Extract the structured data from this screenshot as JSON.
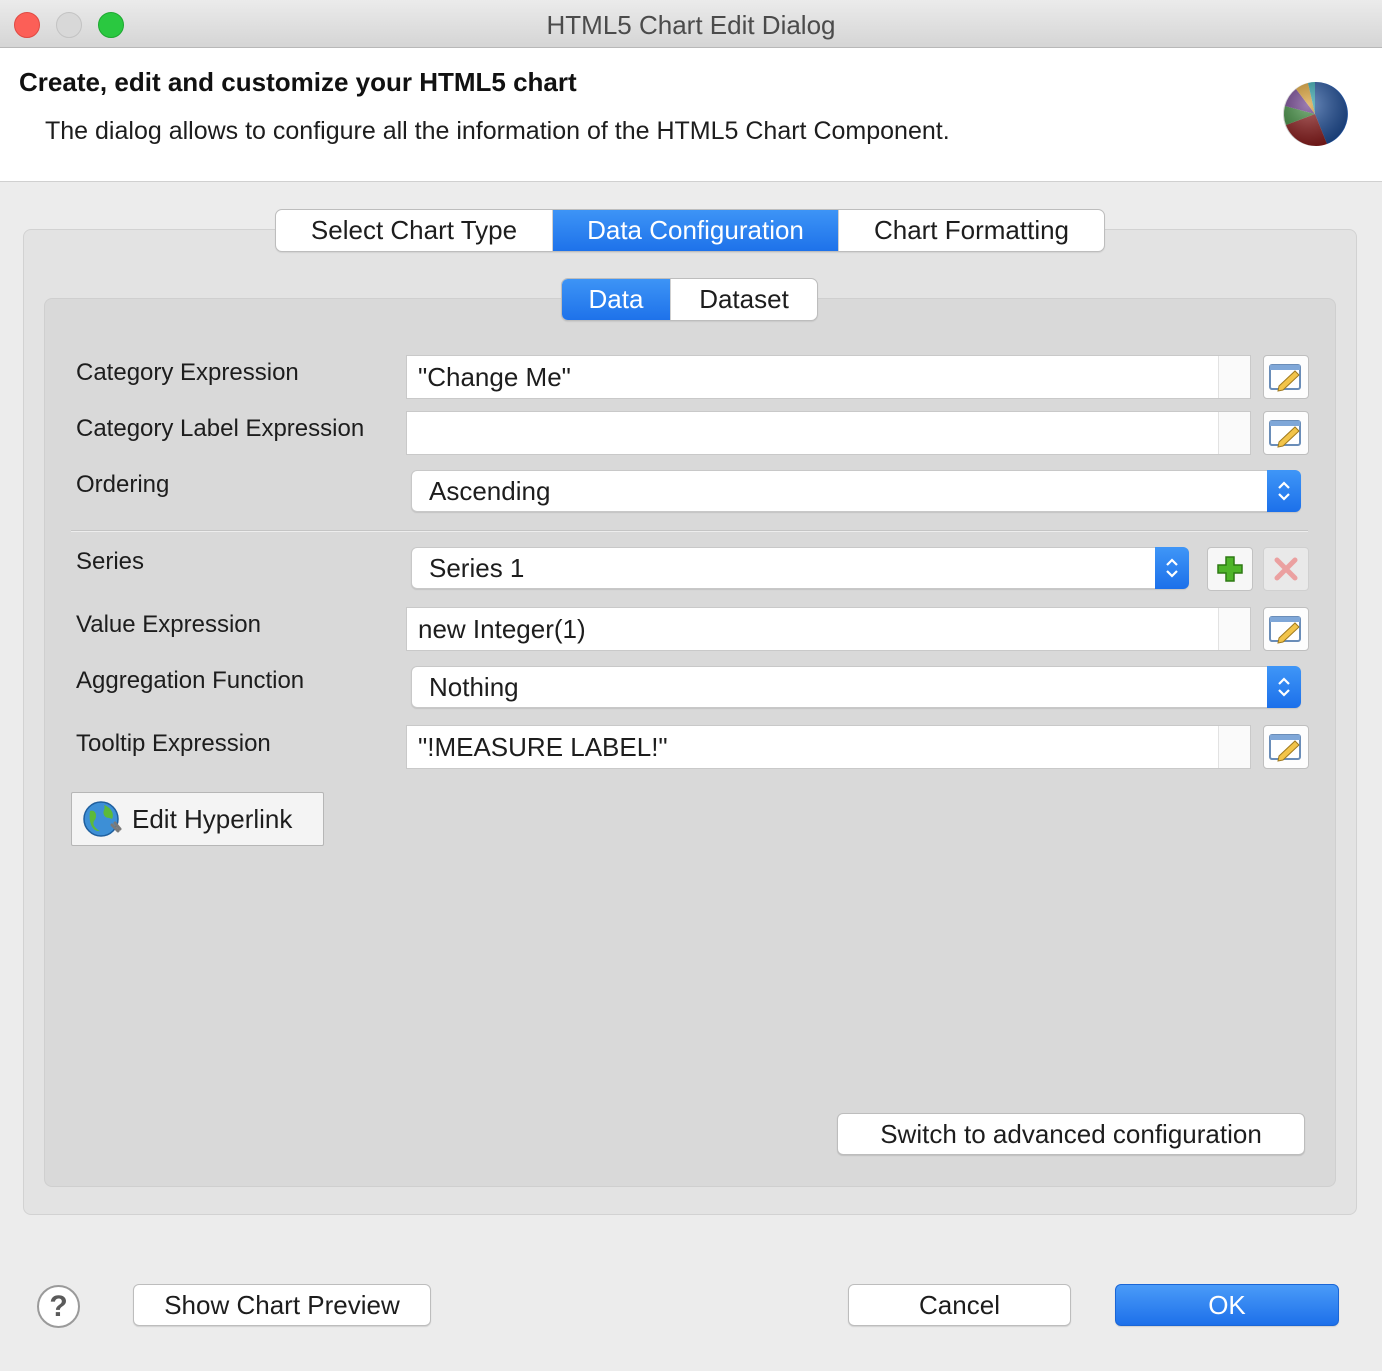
{
  "window": {
    "title": "HTML5 Chart Edit Dialog"
  },
  "banner": {
    "title": "Create, edit and customize your HTML5 chart",
    "description": "The dialog allows to configure all the information of the HTML5 Chart Component.",
    "icon": "pie-chart-icon"
  },
  "main_tabs": [
    {
      "label": "Select Chart Type",
      "active": false
    },
    {
      "label": "Data Configuration",
      "active": true
    },
    {
      "label": "Chart Formatting",
      "active": false
    }
  ],
  "sub_tabs": [
    {
      "label": "Data",
      "active": true
    },
    {
      "label": "Dataset",
      "active": false
    }
  ],
  "form": {
    "category_expression": {
      "label": "Category Expression",
      "value": "\"Change Me\""
    },
    "category_label_expression": {
      "label": "Category Label Expression",
      "value": ""
    },
    "ordering": {
      "label": "Ordering",
      "value": "Ascending"
    },
    "series": {
      "label": "Series",
      "value": "Series 1"
    },
    "value_expression": {
      "label": "Value Expression",
      "value": "new Integer(1)"
    },
    "aggregation_function": {
      "label": "Aggregation Function",
      "value": "Nothing"
    },
    "tooltip_expression": {
      "label": "Tooltip Expression",
      "value": "\"!MEASURE LABEL!\""
    },
    "edit_hyperlink_label": "Edit Hyperlink",
    "advanced_config_label": "Switch to advanced configuration"
  },
  "footer": {
    "help_symbol": "?",
    "show_preview_label": "Show Chart Preview",
    "cancel_label": "Cancel",
    "ok_label": "OK"
  },
  "icons": {
    "expression_editor": "pencil-edit-icon",
    "add_series": "plus-icon",
    "remove_series": "delete-x-icon",
    "hyperlink": "globe-link-icon"
  },
  "colors": {
    "accent": "#1e72ea",
    "add": "#3a9a1c",
    "remove": "#e59a9a"
  }
}
